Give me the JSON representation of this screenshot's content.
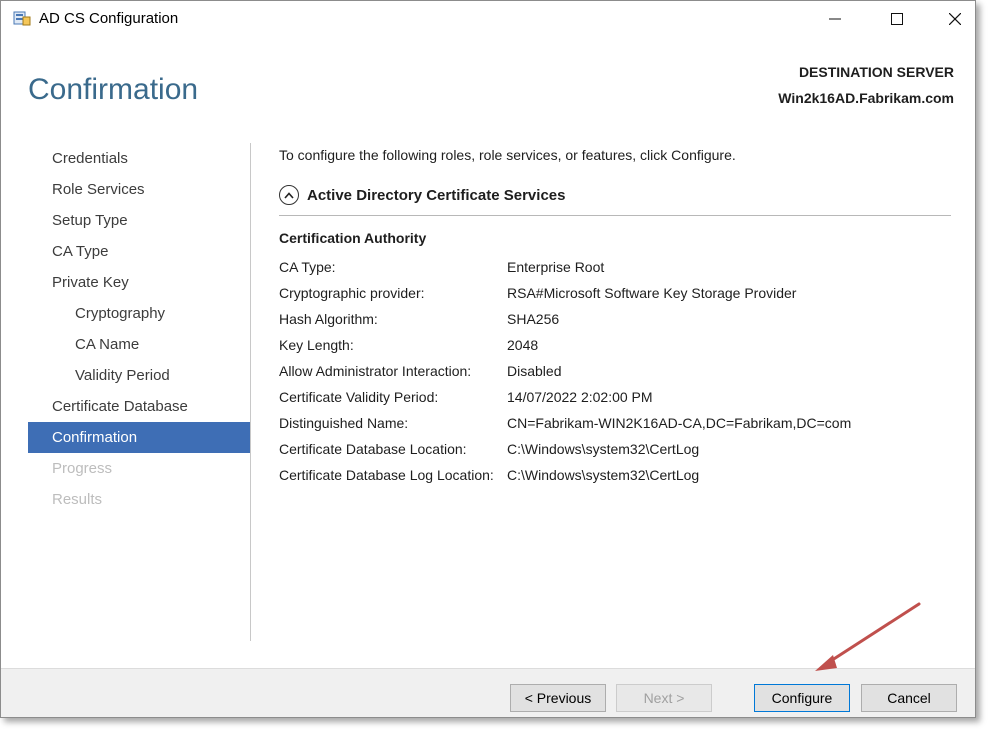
{
  "window": {
    "title": "AD CS Configuration",
    "controls": {
      "minimize": "—",
      "maximize": "☐",
      "close": "✕"
    }
  },
  "header": {
    "page_title": "Confirmation",
    "destination_label": "DESTINATION SERVER",
    "destination_server": "Win2k16AD.Fabrikam.com"
  },
  "nav": {
    "items": [
      {
        "label": "Credentials",
        "state": "normal",
        "level": 1
      },
      {
        "label": "Role Services",
        "state": "normal",
        "level": 1
      },
      {
        "label": "Setup Type",
        "state": "normal",
        "level": 1
      },
      {
        "label": "CA Type",
        "state": "normal",
        "level": 1
      },
      {
        "label": "Private Key",
        "state": "normal",
        "level": 1
      },
      {
        "label": "Cryptography",
        "state": "normal",
        "level": 2
      },
      {
        "label": "CA Name",
        "state": "normal",
        "level": 2
      },
      {
        "label": "Validity Period",
        "state": "normal",
        "level": 2
      },
      {
        "label": "Certificate Database",
        "state": "normal",
        "level": 1
      },
      {
        "label": "Confirmation",
        "state": "active",
        "level": 1
      },
      {
        "label": "Progress",
        "state": "disabled",
        "level": 1
      },
      {
        "label": "Results",
        "state": "disabled",
        "level": 1
      }
    ]
  },
  "content": {
    "intro": "To configure the following roles, role services, or features, click Configure.",
    "section_title": "Active Directory Certificate Services",
    "group_title": "Certification Authority",
    "details": [
      {
        "label": "CA Type:",
        "value": "Enterprise Root"
      },
      {
        "label": "Cryptographic provider:",
        "value": "RSA#Microsoft Software Key Storage Provider"
      },
      {
        "label": "Hash Algorithm:",
        "value": "SHA256"
      },
      {
        "label": "Key Length:",
        "value": "2048"
      },
      {
        "label": "Allow Administrator Interaction:",
        "value": "Disabled"
      },
      {
        "label": "Certificate Validity Period:",
        "value": "14/07/2022 2:02:00 PM"
      },
      {
        "label": "Distinguished Name:",
        "value": "CN=Fabrikam-WIN2K16AD-CA,DC=Fabrikam,DC=com"
      },
      {
        "label": "Certificate Database Location:",
        "value": "C:\\Windows\\system32\\CertLog"
      },
      {
        "label": "Certificate Database Log Location:",
        "value": "C:\\Windows\\system32\\CertLog"
      }
    ]
  },
  "footer": {
    "previous": "< Previous",
    "next": "Next >",
    "configure": "Configure",
    "cancel": "Cancel"
  },
  "colors": {
    "title_blue": "#3a6a8c",
    "nav_active_bg": "#3e6eb5",
    "annotation_arrow": "#c0504d"
  }
}
